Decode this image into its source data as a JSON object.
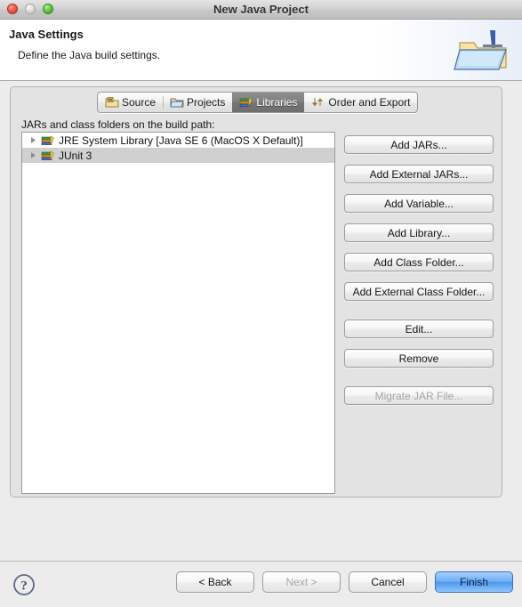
{
  "window": {
    "title": "New Java Project",
    "traffic_lights": [
      "close-light",
      "minimize-light",
      "maximize-light"
    ]
  },
  "header": {
    "title": "Java Settings",
    "subtitle": "Define the Java build settings.",
    "icon": "java-project-folder-icon"
  },
  "tabs": [
    {
      "label": "Source",
      "icon": "source-folder-icon",
      "selected": false
    },
    {
      "label": "Projects",
      "icon": "projects-folder-icon",
      "selected": false
    },
    {
      "label": "Libraries",
      "icon": "libraries-books-icon",
      "selected": true
    },
    {
      "label": "Order and Export",
      "icon": "order-export-arrows-icon",
      "selected": false
    }
  ],
  "main": {
    "tree_label": "JARs and class folders on the build path:",
    "tree_items": [
      {
        "label": "JRE System Library [Java SE 6 (MacOS X Default)]",
        "icon": "library-books-icon",
        "expander": "collapsed-arrow-icon",
        "selected": false
      },
      {
        "label": "JUnit 3",
        "icon": "library-books-icon",
        "expander": "collapsed-arrow-icon",
        "selected": true
      }
    ]
  },
  "side_buttons": [
    {
      "label": "Add JARs...",
      "enabled": true,
      "gap_above": false
    },
    {
      "label": "Add External JARs...",
      "enabled": true,
      "gap_above": false
    },
    {
      "label": "Add Variable...",
      "enabled": true,
      "gap_above": false
    },
    {
      "label": "Add Library...",
      "enabled": true,
      "gap_above": false
    },
    {
      "label": "Add Class Folder...",
      "enabled": true,
      "gap_above": false
    },
    {
      "label": "Add External Class Folder...",
      "enabled": true,
      "gap_above": false
    },
    {
      "label": "Edit...",
      "enabled": true,
      "gap_above": true
    },
    {
      "label": "Remove",
      "enabled": true,
      "gap_above": false
    },
    {
      "label": "Migrate JAR File...",
      "enabled": false,
      "gap_above": true
    }
  ],
  "footer": {
    "help_icon": "help-question-icon",
    "buttons": [
      {
        "label": "< Back",
        "enabled": true,
        "default": false
      },
      {
        "label": "Next >",
        "enabled": false,
        "default": false
      },
      {
        "label": "Cancel",
        "enabled": true,
        "default": false
      },
      {
        "label": "Finish",
        "enabled": true,
        "default": true
      }
    ]
  },
  "colors": {
    "window_bg": "#ececec",
    "panel_bg": "#e3e3e3",
    "selected_tab_bg": "#7e7e7e",
    "selected_row_bg": "#d0d0d0",
    "default_button_blue": "#4e98ef"
  }
}
